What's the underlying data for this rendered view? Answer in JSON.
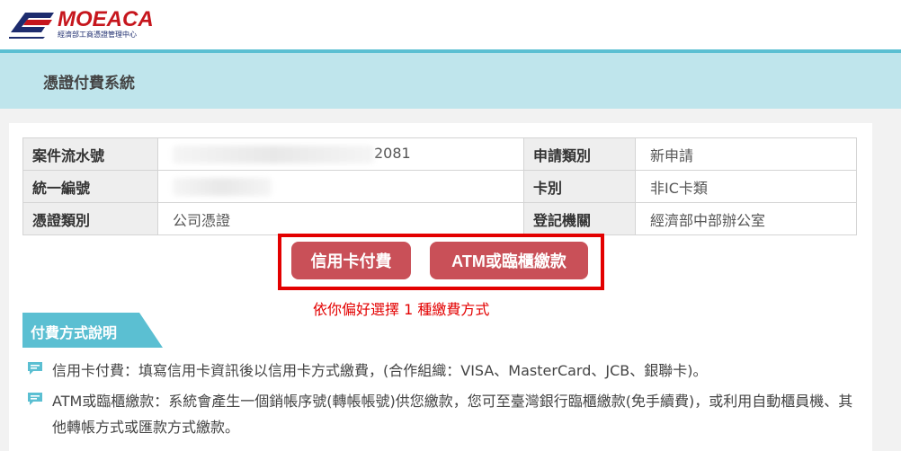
{
  "header": {
    "logo_text": "MOEACA",
    "logo_subtitle": "經濟部工商憑證管理中心",
    "page_title": "憑證付費系統"
  },
  "info_table": {
    "rows": [
      {
        "label": "案件流水號",
        "value": "2081",
        "label2": "申請類別",
        "value2": "新申請"
      },
      {
        "label": "統一編號",
        "value": "",
        "label2": "卡別",
        "value2": "非IC卡類"
      },
      {
        "label": "憑證類別",
        "value": "公司憑證",
        "label2": "登記機關",
        "value2": "經濟部中部辦公室"
      }
    ]
  },
  "payment": {
    "credit_button": "信用卡付費",
    "atm_button": "ATM或臨櫃繳款",
    "hint": "依你偏好選擇 1 種繳費方式"
  },
  "description": {
    "section_title": "付費方式說明",
    "items": [
      "信用卡付費：填寫信用卡資訊後以信用卡方式繳費，(合作組織：VISA、MasterCard、JCB、銀聯卡)。",
      "ATM或臨櫃繳款：系統會產生一個銷帳序號(轉帳帳號)供您繳款，您可至臺灣銀行臨櫃繳款(免手續費)，或利用自動櫃員機、其他轉帳方式或匯款方式繳款。"
    ]
  },
  "colors": {
    "accent": "#5bbfd2",
    "subheader_bg": "#bfe5ec",
    "button": "#c95058",
    "highlight_red": "#e30000",
    "logo_red": "#c6161d",
    "logo_navy": "#1d2c6e"
  },
  "icons": {
    "logo": "moeaca-logo-icon",
    "bullet": "speech-bubble-icon"
  }
}
